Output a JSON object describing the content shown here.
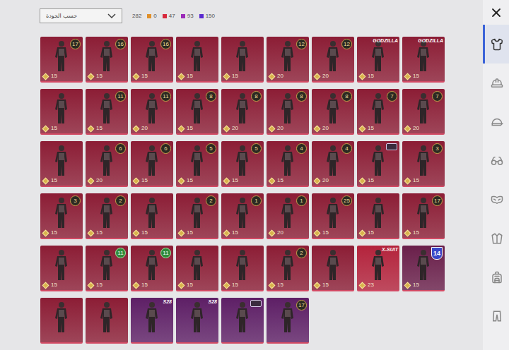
{
  "sort_dropdown": {
    "value": "حسب الجودة",
    "expanded": false
  },
  "total": "282",
  "counts": [
    {
      "value": "0",
      "color": "#e0902a"
    },
    {
      "value": "47",
      "color": "#d8283c"
    },
    {
      "value": "93",
      "color": "#9b2ab8"
    },
    {
      "value": "150",
      "color": "#5a2ad0"
    }
  ],
  "sidebar": {
    "items": [
      {
        "selected": true
      },
      {
        "selected": false
      },
      {
        "selected": false
      },
      {
        "selected": false
      },
      {
        "selected": false
      },
      {
        "selected": false
      },
      {
        "selected": false
      },
      {
        "selected": false
      }
    ]
  },
  "items": [
    {
      "badge": {
        "text": "17",
        "kind": "hex"
      },
      "cost": "15",
      "color": "#8c1d35"
    },
    {
      "badge": {
        "text": "16",
        "kind": "hex"
      },
      "cost": "15",
      "color": "#8c1d35"
    },
    {
      "badge": {
        "text": "16",
        "kind": "hex"
      },
      "cost": "15",
      "color": "#8c1d35"
    },
    {
      "cost": "15",
      "color": "#8c1d35"
    },
    {
      "cost": "15",
      "color": "#8c1d35"
    },
    {
      "badge": {
        "text": "12",
        "kind": "hex"
      },
      "cost": "20",
      "color": "#8c1d35"
    },
    {
      "badge": {
        "text": "12",
        "kind": "hex"
      },
      "cost": "20",
      "color": "#8c1d35"
    },
    {
      "badge": {
        "text": "GODZILLA",
        "kind": "logo"
      },
      "cost": "15",
      "color": "#8c1d35"
    },
    {
      "badge": {
        "text": "GODZILLA",
        "kind": "logo"
      },
      "cost": "15",
      "color": "#8c1d35"
    },
    {
      "cost": "15",
      "color": "#8c1d35"
    },
    {
      "badge": {
        "text": "11",
        "kind": "hex"
      },
      "cost": "15",
      "color": "#8c1d35"
    },
    {
      "badge": {
        "text": "11",
        "kind": "hex"
      },
      "cost": "20",
      "color": "#8c1d35"
    },
    {
      "badge": {
        "text": "8",
        "kind": "hex"
      },
      "cost": "15",
      "color": "#8c1d35"
    },
    {
      "badge": {
        "text": "8",
        "kind": "hex"
      },
      "cost": "20",
      "color": "#8c1d35"
    },
    {
      "badge": {
        "text": "8",
        "kind": "hex"
      },
      "cost": "20",
      "color": "#8c1d35"
    },
    {
      "badge": {
        "text": "8",
        "kind": "hex"
      },
      "cost": "20",
      "color": "#8c1d35"
    },
    {
      "badge": {
        "text": "7",
        "kind": "hex"
      },
      "cost": "15",
      "color": "#8c1d35"
    },
    {
      "badge": {
        "text": "7",
        "kind": "hex"
      },
      "cost": "20",
      "color": "#8c1d35"
    },
    {
      "cost": "15",
      "color": "#8c1d35"
    },
    {
      "badge": {
        "text": "6",
        "kind": "hex"
      },
      "cost": "20",
      "color": "#8c1d35"
    },
    {
      "badge": {
        "text": "6",
        "kind": "hex"
      },
      "cost": "15",
      "color": "#8c1d35"
    },
    {
      "badge": {
        "text": "5",
        "kind": "hex"
      },
      "cost": "15",
      "color": "#8c1d35"
    },
    {
      "badge": {
        "text": "5",
        "kind": "hex"
      },
      "cost": "15",
      "color": "#8c1d35"
    },
    {
      "badge": {
        "text": "4",
        "kind": "hex"
      },
      "cost": "15",
      "color": "#8c1d35"
    },
    {
      "badge": {
        "text": "4",
        "kind": "hex"
      },
      "cost": "20",
      "color": "#8c1d35"
    },
    {
      "badge": {
        "kind": "emblem"
      },
      "cost": "15",
      "color": "#8c1d35"
    },
    {
      "badge": {
        "text": "3",
        "kind": "hex"
      },
      "cost": "15",
      "color": "#8c1d35"
    },
    {
      "badge": {
        "text": "3",
        "kind": "hex"
      },
      "cost": "15",
      "color": "#8c1d35"
    },
    {
      "badge": {
        "text": "2",
        "kind": "hex"
      },
      "cost": "15",
      "color": "#8c1d35"
    },
    {
      "cost": "15",
      "color": "#8c1d35"
    },
    {
      "badge": {
        "text": "2",
        "kind": "hex"
      },
      "cost": "15",
      "color": "#8c1d35"
    },
    {
      "badge": {
        "text": "1",
        "kind": "hex"
      },
      "cost": "15",
      "color": "#8c1d35"
    },
    {
      "badge": {
        "text": "1",
        "kind": "hex"
      },
      "cost": "20",
      "color": "#8c1d35"
    },
    {
      "badge": {
        "text": "25",
        "kind": "hex"
      },
      "cost": "15",
      "color": "#8c1d35"
    },
    {
      "cost": "15",
      "color": "#8c1d35"
    },
    {
      "badge": {
        "text": "17",
        "kind": "hex"
      },
      "cost": "15",
      "color": "#8c1d35"
    },
    {
      "cost": "15",
      "color": "#8c1d35"
    },
    {
      "badge": {
        "text": "11",
        "kind": "green"
      },
      "cost": "15",
      "color": "#8c1d35"
    },
    {
      "badge": {
        "text": "11",
        "kind": "green"
      },
      "cost": "15",
      "color": "#8c1d35"
    },
    {
      "cost": "15",
      "color": "#8c1d35"
    },
    {
      "cost": "15",
      "color": "#8c1d35"
    },
    {
      "badge": {
        "text": "2",
        "kind": "hex"
      },
      "cost": "15",
      "color": "#8c1d35"
    },
    {
      "cost": "15",
      "color": "#8c1d35"
    },
    {
      "badge": {
        "text": "X-SUIT",
        "kind": "logo"
      },
      "cost": "23",
      "color": "#b4233c"
    },
    {
      "badge": {
        "text": "14",
        "kind": "shield"
      },
      "cost": "15",
      "color": "#6a1f4a"
    },
    {
      "color": "#8c1d35"
    },
    {
      "color": "#8c1d35"
    },
    {
      "badge": {
        "text": "S28",
        "kind": "logo"
      },
      "color": "#5e1f66"
    },
    {
      "badge": {
        "text": "S28",
        "kind": "logo"
      },
      "color": "#5e1f66"
    },
    {
      "badge": {
        "kind": "emblem"
      },
      "color": "#5e1f66"
    },
    {
      "badge": {
        "text": "17",
        "kind": "hex"
      },
      "color": "#5e1f66"
    }
  ]
}
